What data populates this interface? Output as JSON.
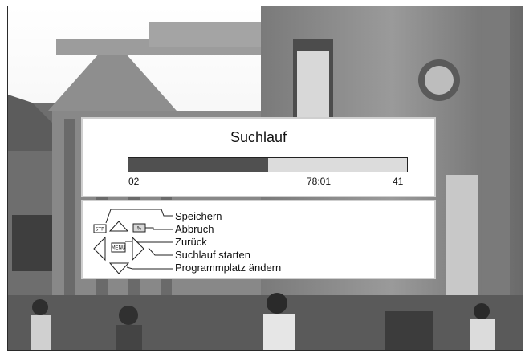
{
  "osd": {
    "title": "Suchlauf",
    "progress": {
      "fraction": 0.5,
      "start_label": "02",
      "frequency_label": "78:01",
      "end_label": "41"
    }
  },
  "help": {
    "keys": {
      "store": "STR",
      "cancel": "%",
      "menu": "MENU"
    },
    "items": [
      "Speichern",
      "Abbruch",
      "Zurück",
      "Suchlauf starten",
      "Programmplatz ändern"
    ]
  },
  "colors": {
    "progress_fill": "#505050",
    "progress_track": "#dcdcdc",
    "panel_bg": "#ffffff"
  },
  "icons": [
    "store-key-icon",
    "cancel-key-icon",
    "menu-key-icon",
    "arrow-up-icon",
    "arrow-down-icon",
    "arrow-left-icon",
    "arrow-right-icon"
  ]
}
